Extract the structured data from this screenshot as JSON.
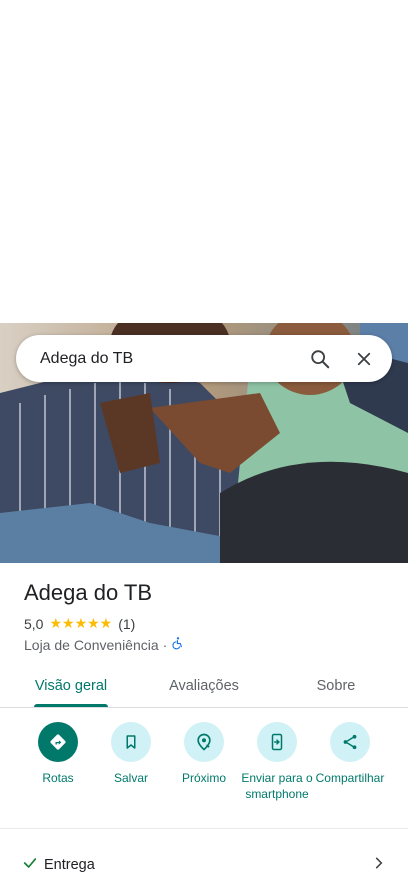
{
  "search": {
    "query": "Adega do TB"
  },
  "place": {
    "name": "Adega do TB",
    "rating": "5,0",
    "stars": "★★★★★",
    "review_count": "(1)",
    "category": "Loja de Conveniência",
    "separator": "·"
  },
  "tabs": [
    {
      "label": "Visão geral",
      "active": true
    },
    {
      "label": "Avaliações",
      "active": false
    },
    {
      "label": "Sobre",
      "active": false
    }
  ],
  "actions": [
    {
      "label": "Rotas",
      "icon": "directions-icon"
    },
    {
      "label": "Salvar",
      "icon": "bookmark-icon"
    },
    {
      "label": "Próximo",
      "icon": "nearby-icon"
    },
    {
      "label": "Enviar para o smartphone",
      "icon": "send-to-phone-icon"
    },
    {
      "label": "Compartilhar",
      "icon": "share-icon"
    }
  ],
  "delivery": {
    "label": "Entrega",
    "icon": "check-icon"
  },
  "colors": {
    "accent": "#00796b",
    "chip": "#d0f1f5",
    "star": "#fbbc04"
  }
}
